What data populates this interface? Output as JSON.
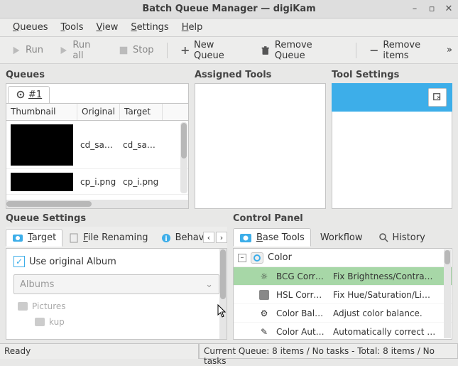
{
  "window": {
    "title": "Batch Queue Manager — digiKam"
  },
  "menus": {
    "queues": "Queues",
    "tools": "Tools",
    "view": "View",
    "settings": "Settings",
    "help": "Help"
  },
  "toolbar": {
    "run": "Run",
    "run_all": "Run all",
    "stop": "Stop",
    "new_queue": "New Queue",
    "remove_queue": "Remove Queue",
    "remove_items": "Remove items"
  },
  "labels": {
    "queues": "Queues",
    "assigned_tools": "Assigned Tools",
    "tool_settings": "Tool Settings",
    "queue_settings": "Queue Settings",
    "control_panel": "Control Panel"
  },
  "queues": {
    "active_tab": "#1",
    "columns": {
      "thumbnail": "Thumbnail",
      "original": "Original",
      "target": "Target"
    },
    "rows": [
      {
        "original": "cd_sam…",
        "target": "cd_sample"
      },
      {
        "original": "cp_i.png",
        "target": "cp_i.png"
      }
    ]
  },
  "queue_settings": {
    "tabs": {
      "target": "Target",
      "file_renaming": "File Renaming",
      "behavior": "Behavi"
    },
    "use_original_album": "Use original Album",
    "albums_combo": "Albums",
    "tree": {
      "pictures": "Pictures",
      "kup": "kup"
    }
  },
  "control_panel": {
    "tabs": {
      "base_tools": "Base Tools",
      "workflow": "Workflow",
      "history": "History"
    },
    "category": "Color",
    "tools": [
      {
        "name": "BCG Corr…",
        "desc": "Fix Brightness/Contra…",
        "selected": true
      },
      {
        "name": "HSL Corre…",
        "desc": "Fix Hue/Saturation/Li…",
        "selected": false
      },
      {
        "name": "Color Bal…",
        "desc": "Adjust color balance.",
        "selected": false
      },
      {
        "name": "Color Aut…",
        "desc": "Automatically correct …",
        "selected": false
      }
    ]
  },
  "status": {
    "left": "Ready",
    "right": "Current Queue: 8 items / No tasks - Total: 8 items / No tasks"
  }
}
